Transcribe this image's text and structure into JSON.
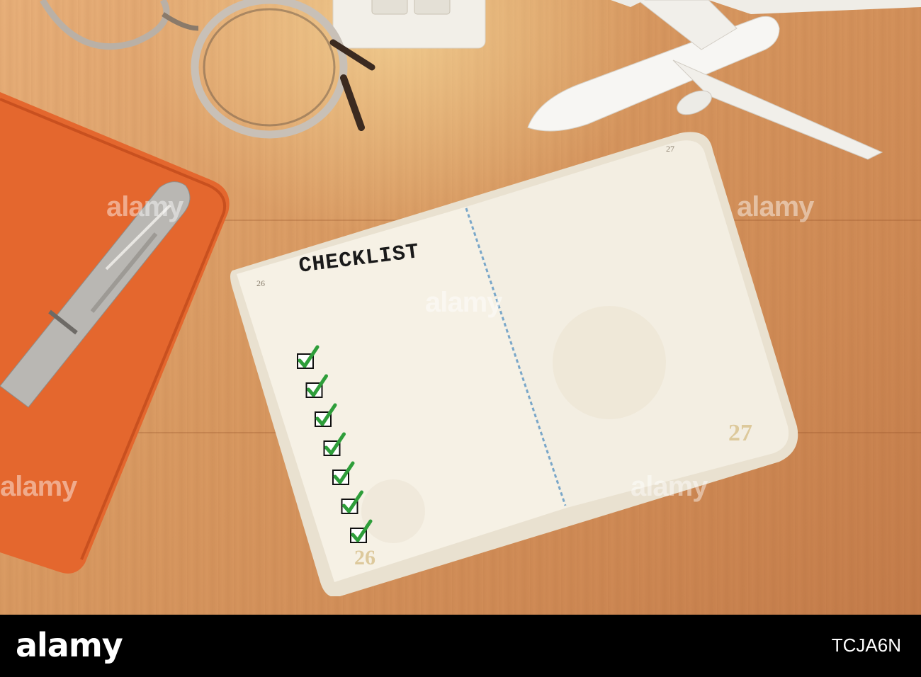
{
  "scene": {
    "checklist_title": "CHECKLIST",
    "page_left_number": "26",
    "page_right_number": "27",
    "checked_item_count": 7
  },
  "watermarks": [
    "alamy",
    "alamy",
    "alamy",
    "alamy",
    "alamy",
    "alamy",
    "alamy",
    "alamy",
    "alamy",
    "alamy"
  ],
  "footer": {
    "brand": "alamy",
    "image_id": "TCJA6N"
  },
  "colors": {
    "wood": "#d99a62",
    "notebook": "#e4672e",
    "check_green": "#2e9e3a",
    "paper": "#f4efe3"
  }
}
